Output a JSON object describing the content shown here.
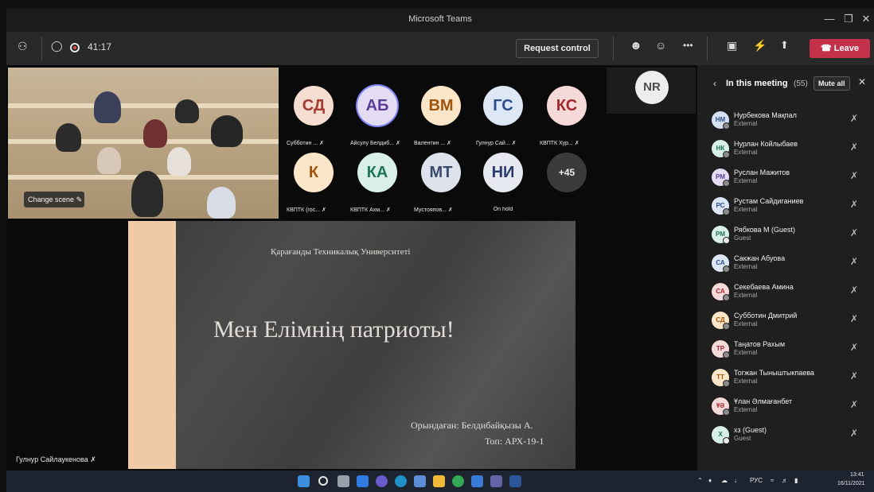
{
  "window": {
    "title": "Microsoft Teams"
  },
  "toolbar": {
    "timer": "41:17",
    "request_control": "Request control",
    "leave": "Leave",
    "more": "•••"
  },
  "room": {
    "change_scene": "Change scene"
  },
  "tiles": [
    {
      "initials": "СД",
      "label": "Субботин ...",
      "bg": "#f5ddd2",
      "fg": "#a23c2f"
    },
    {
      "initials": "АБ",
      "label": "Айсулу Белдиб...",
      "bg": "#e4dcf2",
      "fg": "#5a3d99"
    },
    {
      "initials": "ВМ",
      "label": "Валентин ...",
      "bg": "#fbe6c9",
      "fg": "#a1540c"
    },
    {
      "initials": "ГС",
      "label": "Гулнур Сай...",
      "bg": "#dde7f5",
      "fg": "#2c4f8a"
    },
    {
      "initials": "КС",
      "label": "КВПТК Хур...",
      "bg": "#f6dada",
      "fg": "#a3292f"
    },
    {
      "initials": "К",
      "label": "КВПТК (гос...",
      "bg": "#fbe6c9",
      "fg": "#a1540c"
    },
    {
      "initials": "КА",
      "label": "КВПТК Ахм...",
      "bg": "#d9f0e6",
      "fg": "#1e7553"
    },
    {
      "initials": "МТ",
      "label": "Мустояпов...",
      "bg": "#dde2ec",
      "fg": "#3a4a6a"
    },
    {
      "initials": "НИ",
      "label": "On hold",
      "bg": "#e6e9ef",
      "fg": "#2a3a6e"
    },
    {
      "initials": "+45",
      "label": "",
      "bg": "#3b3b3b",
      "fg": "#f0f0f0"
    }
  ],
  "nr_tile": {
    "initials": "NR"
  },
  "slide": {
    "university": "Қарағанды Техникалық Университеті",
    "title": "Мен Елімнің патриоты!",
    "author": "Орындаған: Белдибайқызы А.",
    "group": "Топ: АРХ-19-1"
  },
  "presenter": {
    "name": "Гулнур Сайлаукенова"
  },
  "panel": {
    "title": "In this meeting",
    "count": "(55)",
    "mute_all": "Mute all",
    "participants": [
      {
        "initials": "НМ",
        "name": "Нурбекова Мақпал",
        "role": "External",
        "bg": "#d6e0f3",
        "fg": "#2c4f8a"
      },
      {
        "initials": "НК",
        "name": "Нурлан Койлыбаев",
        "role": "External",
        "bg": "#d9f0e6",
        "fg": "#1e7553"
      },
      {
        "initials": "РМ",
        "name": "Руслан Мажитов",
        "role": "External",
        "bg": "#e4dcf2",
        "fg": "#5a3d99"
      },
      {
        "initials": "РС",
        "name": "Рустам Сайдиганиев",
        "role": "External",
        "bg": "#dde7f5",
        "fg": "#2c4f8a"
      },
      {
        "initials": "РМ",
        "name": "Рябкова М (Guest)",
        "role": "Guest",
        "bg": "#d9f0e6",
        "fg": "#1e7553"
      },
      {
        "initials": "СА",
        "name": "Сакжан Абуова",
        "role": "External",
        "bg": "#dde7f5",
        "fg": "#2c4f8a"
      },
      {
        "initials": "СА",
        "name": "Секебаева Амина",
        "role": "External",
        "bg": "#f6dada",
        "fg": "#a3292f"
      },
      {
        "initials": "СД",
        "name": "Субботин Дмитрий",
        "role": "External",
        "bg": "#fbe6c9",
        "fg": "#a1540c"
      },
      {
        "initials": "ТР",
        "name": "Таңатов Рахым",
        "role": "External",
        "bg": "#f6dada",
        "fg": "#a3292f"
      },
      {
        "initials": "ТТ",
        "name": "Тогжан Тыныштыкпаева",
        "role": "External",
        "bg": "#fbe6c9",
        "fg": "#a1540c"
      },
      {
        "initials": "ҰӘ",
        "name": "Ұлан Әлмағанбет",
        "role": "External",
        "bg": "#f6dada",
        "fg": "#a3292f"
      },
      {
        "initials": "Х",
        "name": "хз (Guest)",
        "role": "Guest",
        "bg": "#d9f0e6",
        "fg": "#1e7553"
      }
    ]
  },
  "taskbar": {
    "lang": "РУС",
    "time": "13:41",
    "date": "16/11/2021"
  }
}
